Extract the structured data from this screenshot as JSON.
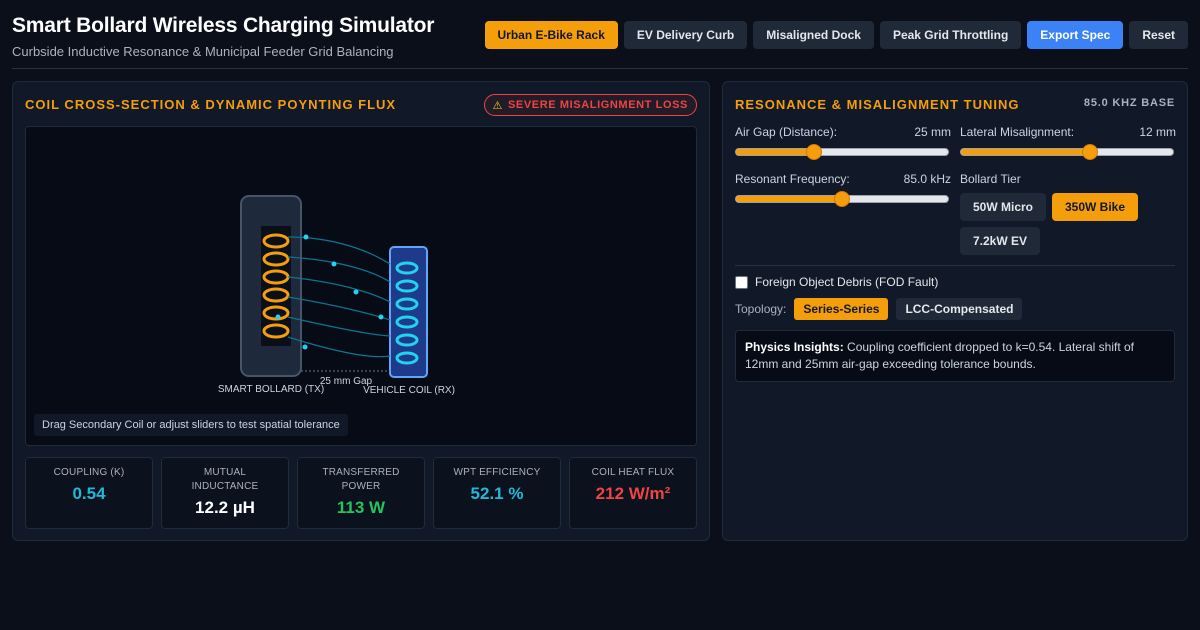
{
  "header": {
    "title": "Smart Bollard Wireless Charging Simulator",
    "subtitle": "Curbside Inductive Resonance & Municipal Feeder Grid Balancing",
    "presets": [
      {
        "label": "Urban E-Bike Rack",
        "active": true
      },
      {
        "label": "EV Delivery Curb",
        "active": false
      },
      {
        "label": "Misaligned Dock",
        "active": false
      },
      {
        "label": "Peak Grid Throttling",
        "active": false
      }
    ],
    "export_label": "Export Spec",
    "reset_label": "Reset"
  },
  "left_panel": {
    "title": "COIL CROSS-SECTION & DYNAMIC POYNTING FLUX",
    "warning": "SEVERE MISALIGNMENT LOSS",
    "viz": {
      "tx_label": "SMART BOLLARD (TX)",
      "rx_label": "VEHICLE COIL (RX)",
      "gap_label": "25 mm Gap",
      "hint": "Drag Secondary Coil or adjust sliders to test spatial tolerance"
    },
    "metrics": [
      {
        "label": "COUPLING (K)",
        "value": "0.54",
        "color": "#22b8d6"
      },
      {
        "label": "MUTUAL INDUCTANCE",
        "value": "12.2 µH",
        "color": "#ffffff"
      },
      {
        "label": "TRANSFERRED POWER",
        "value": "113 W",
        "color": "#22c55e"
      },
      {
        "label": "WPT EFFICIENCY",
        "value": "52.1 %",
        "color": "#22b8d6"
      },
      {
        "label": "COIL HEAT FLUX",
        "value": "212 W/m²",
        "color": "#ef4444"
      }
    ]
  },
  "right_panel": {
    "title": "RESONANCE & MISALIGNMENT TUNING",
    "base_label": "85.0 KHZ BASE",
    "air_gap": {
      "label": "Air Gap (Distance):",
      "value": "25 mm",
      "fraction": 0.37
    },
    "lateral": {
      "label": "Lateral Misalignment:",
      "value": "12 mm",
      "fraction": 0.61
    },
    "frequency": {
      "label": "Resonant Frequency:",
      "value": "85.0 kHz",
      "fraction": 0.5
    },
    "tier": {
      "label": "Bollard Tier",
      "options": [
        {
          "label": "50W Micro",
          "active": false
        },
        {
          "label": "350W Bike",
          "active": true
        },
        {
          "label": "7.2kW EV",
          "active": false
        }
      ]
    },
    "fod_label": "Foreign Object Debris (FOD Fault)",
    "topology": {
      "label": "Topology:",
      "options": [
        {
          "label": "Series-Series",
          "active": true
        },
        {
          "label": "LCC-Compensated",
          "active": false
        }
      ]
    },
    "insight": {
      "heading": "Physics Insights:",
      "text": "Coupling coefficient dropped to k=0.54. Lateral shift of 12mm and 25mm air-gap exceeding tolerance bounds."
    }
  },
  "colors": {
    "accent": "#f59e0b",
    "primary": "#3b82f6",
    "danger": "#ef4444",
    "cyan": "#22b8d6",
    "success": "#22c55e"
  }
}
